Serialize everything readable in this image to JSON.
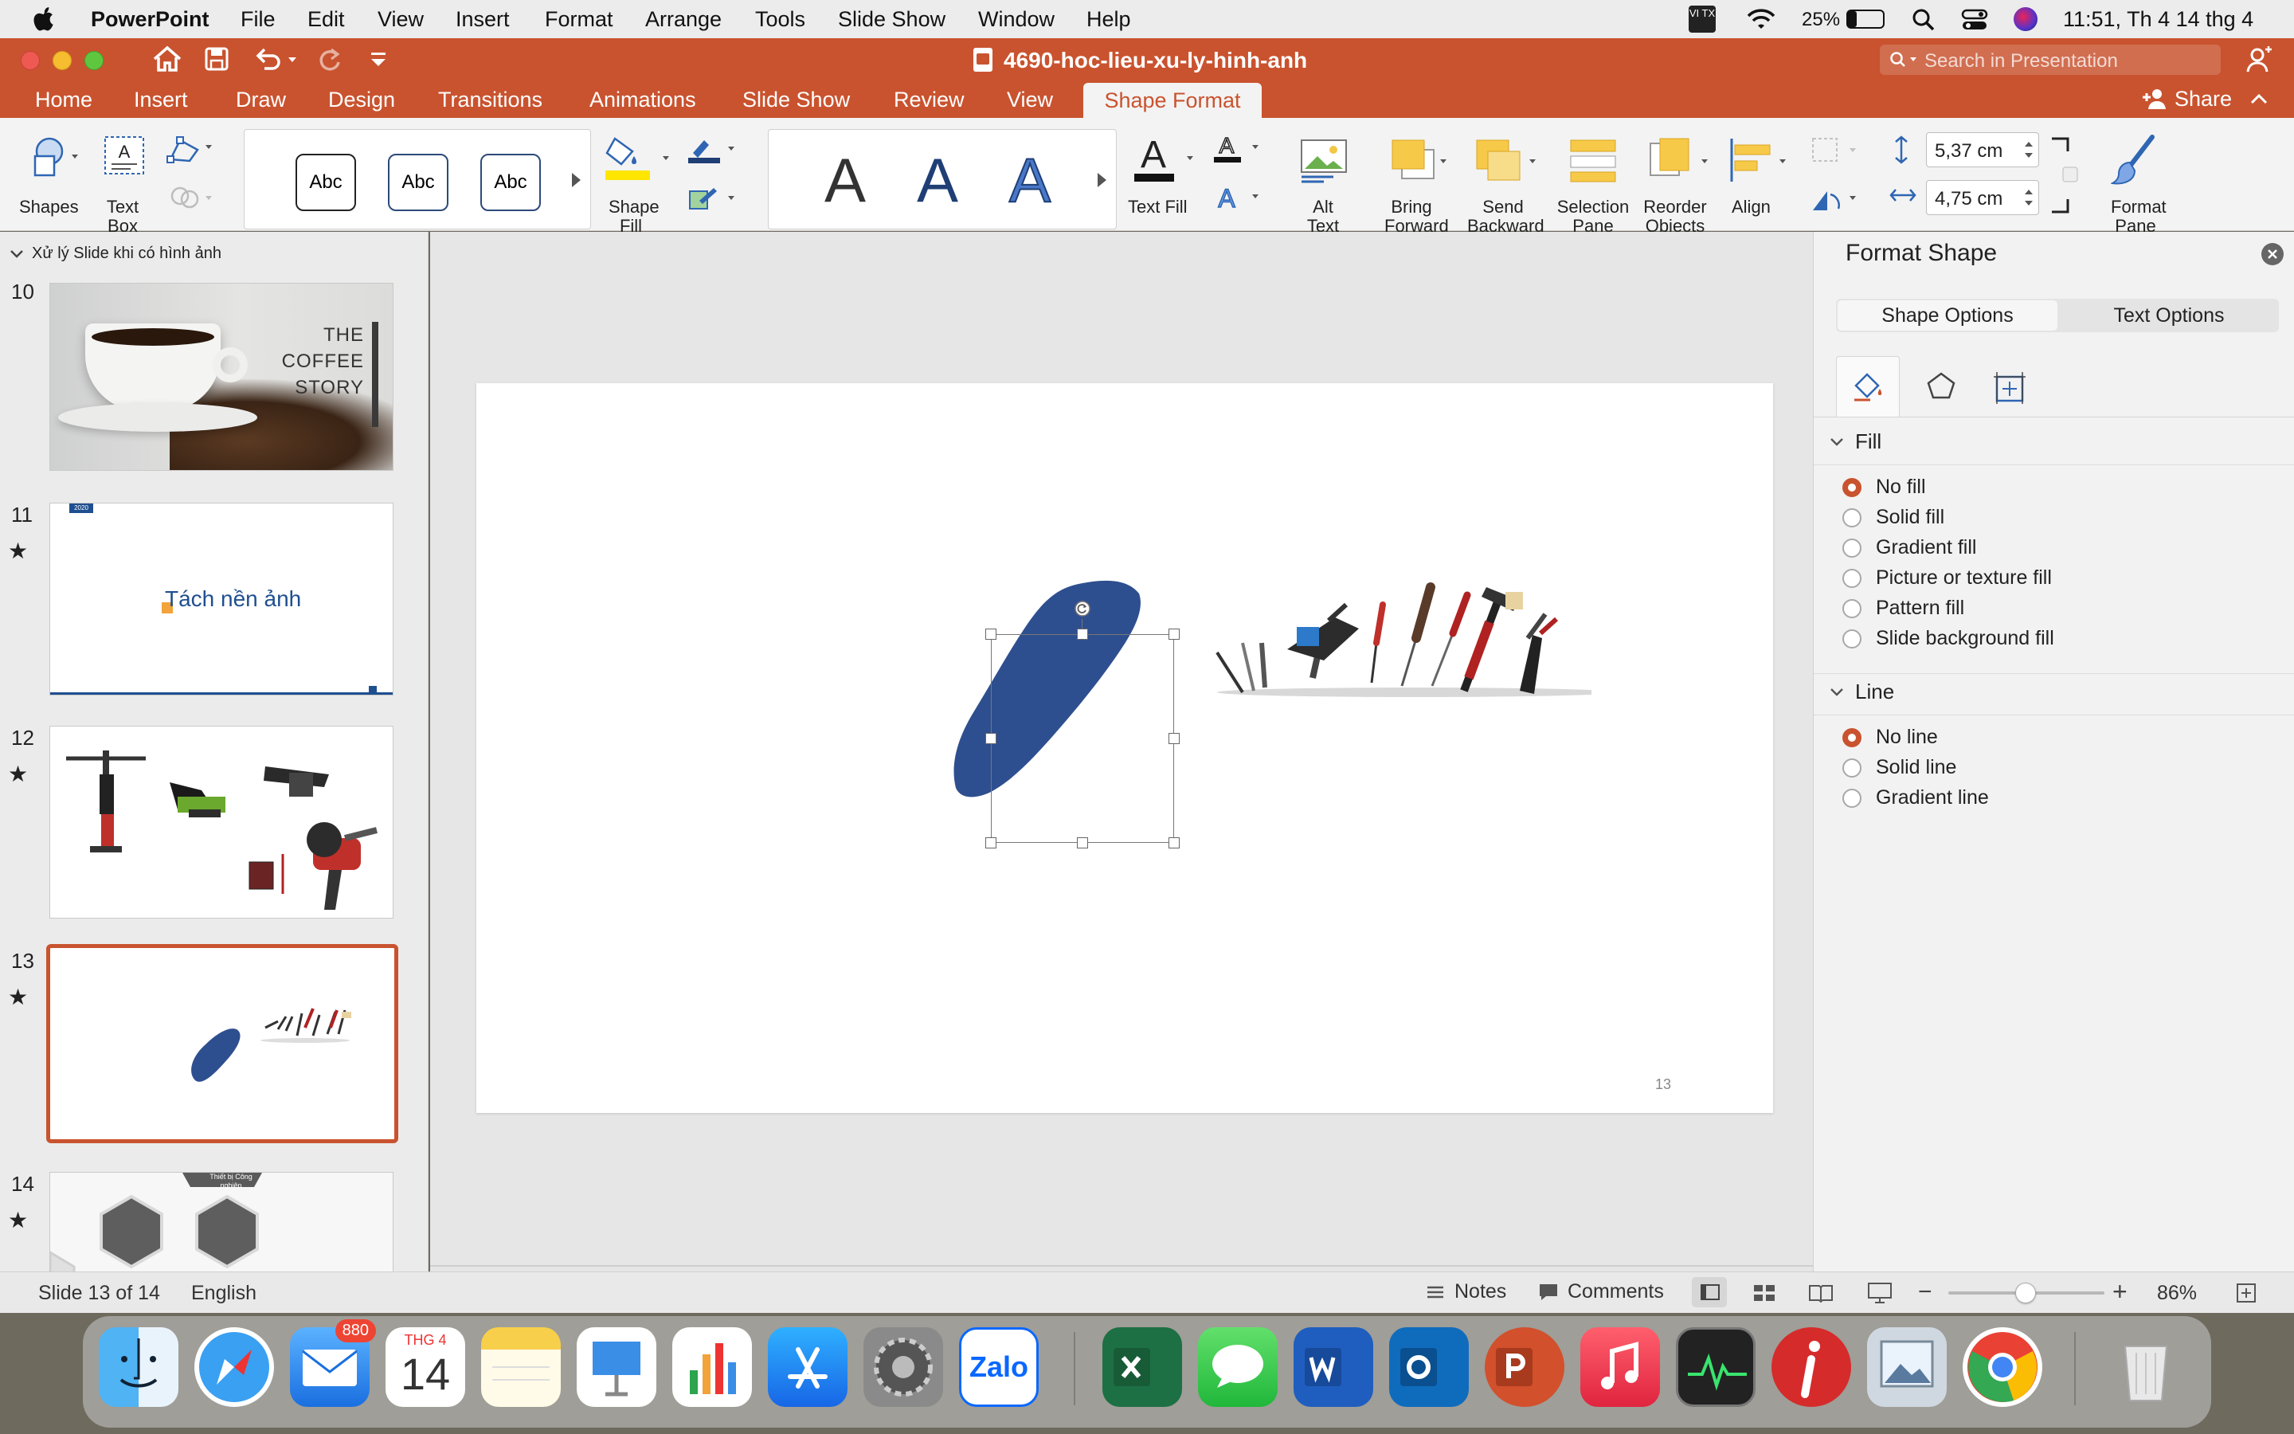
{
  "menubar": {
    "app": "PowerPoint",
    "items": [
      "File",
      "Edit",
      "View",
      "Insert",
      "Format",
      "Arrange",
      "Tools",
      "Slide Show",
      "Window",
      "Help"
    ],
    "input_method": "VI TX",
    "battery": "25%",
    "clock": "11:51, Th 4 14 thg 4"
  },
  "titlebar": {
    "doc_title": "4690-hoc-lieu-xu-ly-hinh-anh",
    "search_placeholder": "Search in Presentation"
  },
  "tabs": {
    "items": [
      "Home",
      "Insert",
      "Draw",
      "Design",
      "Transitions",
      "Animations",
      "Slide Show",
      "Review",
      "View",
      "Shape Format"
    ],
    "active": "Shape Format",
    "share": "Share"
  },
  "ribbon": {
    "shapes": "Shapes",
    "text_box": "Text Box",
    "style_abc": "Abc",
    "shape_fill": "Shape Fill",
    "wordart_a": "A",
    "text_fill": "Text Fill",
    "alt_text": "Alt Text",
    "bring_forward": "Bring Forward",
    "send_backward": "Send Backward",
    "selection_pane": "Selection Pane",
    "reorder_objects": "Reorder Objects",
    "align": "Align",
    "height": "5,37 cm",
    "width": "4,75 cm",
    "format_pane": "Format Pane"
  },
  "thumbs": {
    "section": "Xử lý Slide khi có hình ảnh",
    "slide10_text": [
      "THE",
      "COFFEE",
      "STORY"
    ],
    "slide11_title": "Tách nền ảnh",
    "slide11_tag": "2020",
    "slide14_label": "Thiết bị Công nghiệp",
    "numbers": [
      "10",
      "11",
      "12",
      "13",
      "14"
    ],
    "star": "★"
  },
  "slide": {
    "page_number": "13"
  },
  "pane": {
    "title": "Format Shape",
    "tab_shape": "Shape Options",
    "tab_text": "Text Options",
    "fill_header": "Fill",
    "fill_options": [
      "No fill",
      "Solid fill",
      "Gradient fill",
      "Picture or texture fill",
      "Pattern fill",
      "Slide background fill"
    ],
    "line_header": "Line",
    "line_options": [
      "No line",
      "Solid line",
      "Gradient line"
    ],
    "fill_selected": "No fill",
    "line_selected": "No line"
  },
  "status": {
    "slide_count": "Slide 13 of 14",
    "language": "English",
    "notes": "Notes",
    "comments": "Comments",
    "zoom": "86%"
  },
  "dock": {
    "mail_badge": "880",
    "calendar_month": "THG 4",
    "calendar_day": "14",
    "zalo": "Zalo"
  },
  "colors": {
    "accent": "#c9532f",
    "shape_blue": "#2e4f8f"
  }
}
